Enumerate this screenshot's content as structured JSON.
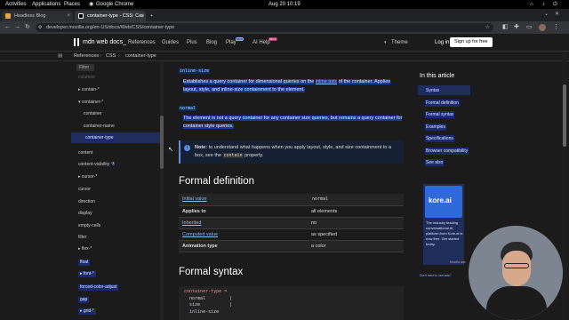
{
  "gnome": {
    "activities": "Activities",
    "applications": "Applications",
    "places": "Places",
    "app": "Google Chrome",
    "clock": "Aug 20  10:19"
  },
  "tabs": [
    {
      "title": "Headless Blog",
      "active": false
    },
    {
      "title": "container-type - CSS: Cas",
      "active": true
    }
  ],
  "address": {
    "url": "developer.mozilla.org/en-US/docs/Web/CSS/container-type"
  },
  "mdn": {
    "logo": "mdn web docs_",
    "nav": [
      "References",
      "Guides",
      "Plus",
      "Blog",
      "Play",
      "AI Help"
    ],
    "play_badge": "NEW",
    "ai_badge": "BETA",
    "theme": "Theme",
    "login": "Log in",
    "signup": "Sign up for free"
  },
  "breadcrumbs": [
    "References",
    "CSS",
    "container-type"
  ],
  "sidebar": {
    "filter_placeholder": "Filter",
    "items": [
      "columns",
      "contain-*",
      "container-*",
      "container",
      "container-name",
      "container-type",
      "content",
      "content-visibility",
      "cursor-*",
      "cursor",
      "direction",
      "display",
      "empty-cells",
      "filter",
      "flex-*",
      "float",
      "font-*",
      "forced-color-adjust",
      "gap",
      "grid-*"
    ]
  },
  "main": {
    "inline_size_code": "inline-size",
    "inline_size_desc_1": "Establishes a query container for dimensional queries on the",
    "inline_axis_link": "inline axis",
    "inline_size_desc_2": "of the container. Applies layout, style, and inline-size containment to the element.",
    "normal_code": "normal",
    "normal_desc": "The element is not a query container for any container size queries, but remains a query container for container style queries.",
    "note_label": "Note:",
    "note_text": "to understand what happens when you apply layout, style, and size containment to a box, see the",
    "note_code": "contain",
    "note_tail": "property.",
    "formal_definition_heading": "Formal definition",
    "definition_rows": [
      {
        "label": "Initial value",
        "value": "normal",
        "label_link": true,
        "value_code": true
      },
      {
        "label": "Applies to",
        "value": "all elements",
        "label_link": false,
        "value_code": false
      },
      {
        "label": "Inherited",
        "value": "no",
        "label_link": true,
        "value_code": false
      },
      {
        "label": "Computed value",
        "value": "as specified",
        "label_link": true,
        "value_code": false
      },
      {
        "label": "Animation type",
        "value": "a color",
        "label_link": false,
        "value_code": false
      }
    ],
    "formal_syntax_heading": "Formal syntax",
    "syntax_lines": [
      "container-type =",
      "  normal         |",
      "  size           |",
      "  inline-size"
    ]
  },
  "toc": {
    "heading": "In this article",
    "items": [
      "Syntax",
      "Formal definition",
      "Formal syntax",
      "Examples",
      "Specifications",
      "Browser compatibility",
      "See also"
    ]
  },
  "ad": {
    "brand": "kore.ai",
    "text": "The industry leading conversational AI platform from Kore.ai is now free. Get started today.",
    "by": "Mozilla ads",
    "footer": "Don't want to see ads?"
  },
  "colors": {
    "accent": "#8cb4ff",
    "selection": "#1c3a8a",
    "background": "#1b1b1b"
  }
}
